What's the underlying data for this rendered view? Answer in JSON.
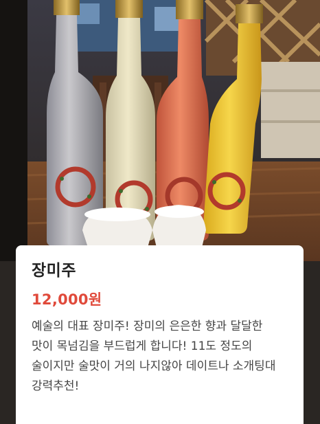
{
  "product": {
    "name": "장미주",
    "price": "12,000원",
    "description": "예술의 대표 장미주! 장미의 은은한 향과 달달한 맛이 목넘김을 부드럽게 합니다! 11도 정도의 술이지만 술맛이 거의 나지않아 데이트나 소개팅대 강력추천!"
  },
  "colors": {
    "price": "#e04a3b",
    "title": "#222222",
    "description": "#444444"
  },
  "image": {
    "subject": "four-bottles-of-rose-wine-on-wooden-table"
  }
}
